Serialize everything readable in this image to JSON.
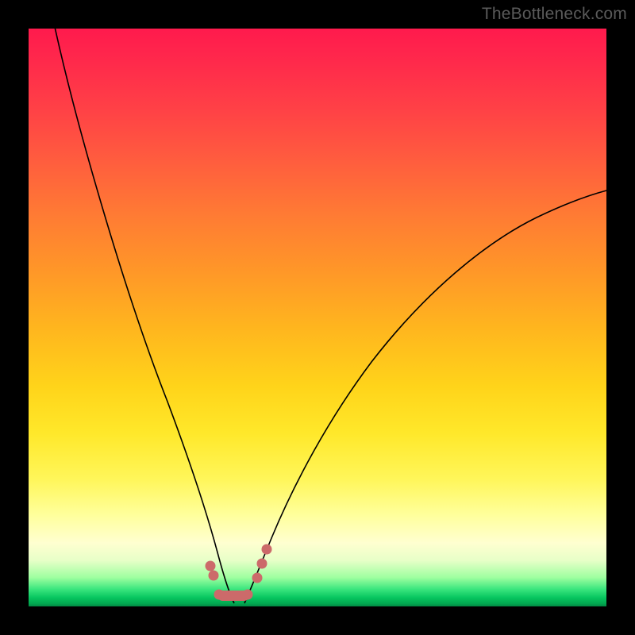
{
  "watermark": "TheBottleneck.com",
  "chart_data": {
    "type": "line",
    "title": "",
    "xlabel": "",
    "ylabel": "",
    "xlim": [
      0,
      100
    ],
    "ylim": [
      0,
      100
    ],
    "grid": false,
    "legend": false,
    "series": [
      {
        "name": "left-branch",
        "x": [
          4,
          7,
          10,
          13,
          16,
          19,
          22,
          25,
          27,
          29,
          31,
          32.5,
          33.5,
          34.3
        ],
        "y": [
          100,
          90,
          80,
          70,
          60,
          50,
          40,
          30,
          22,
          16,
          10,
          6,
          3,
          1
        ]
      },
      {
        "name": "right-branch",
        "x": [
          38.2,
          39,
          40,
          41.5,
          43,
          46,
          50,
          55,
          61,
          68,
          76,
          84,
          92,
          100
        ],
        "y": [
          1,
          3,
          6,
          10,
          14,
          21,
          29,
          37,
          45,
          52,
          58,
          63,
          67,
          70
        ]
      },
      {
        "name": "bottom-dots",
        "x": [
          31.5,
          32.0,
          33.0,
          34.0,
          35.2,
          36.4,
          37.6,
          39.5,
          40.4,
          41.3
        ],
        "y": [
          7.0,
          5.3,
          2.0,
          0.9,
          0.7,
          0.7,
          0.9,
          5.0,
          7.4,
          10.0
        ]
      }
    ],
    "colors": {
      "curve": "#000000",
      "dots": "#cc6a6a"
    }
  }
}
